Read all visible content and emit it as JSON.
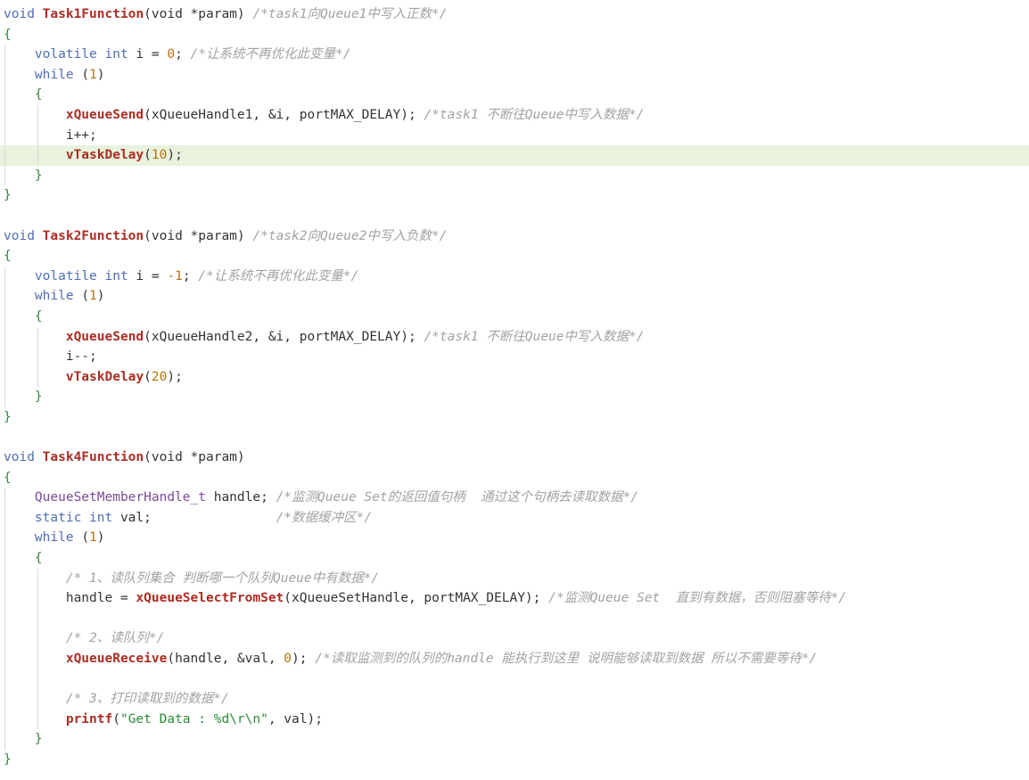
{
  "editor": {
    "lines": [
      {
        "indent": 0,
        "highlight": false,
        "tokens": [
          {
            "c": "kw",
            "t": "void "
          },
          {
            "c": "fn",
            "t": "Task1Function"
          },
          {
            "c": "paren",
            "t": "(void *param) "
          },
          {
            "c": "cm",
            "t": "/*task1向Queue1中写入正数*/"
          }
        ]
      },
      {
        "indent": 0,
        "highlight": false,
        "tokens": [
          {
            "c": "br-green",
            "t": "{"
          }
        ]
      },
      {
        "indent": 1,
        "highlight": false,
        "tokens": [
          {
            "c": "kw",
            "t": "volatile int "
          },
          {
            "c": "id",
            "t": "i = "
          },
          {
            "c": "num",
            "t": "0"
          },
          {
            "c": "op",
            "t": "; "
          },
          {
            "c": "cm",
            "t": "/*让系统不再优化此变量*/"
          }
        ]
      },
      {
        "indent": 1,
        "highlight": false,
        "tokens": [
          {
            "c": "kw",
            "t": "while "
          },
          {
            "c": "paren",
            "t": "("
          },
          {
            "c": "num",
            "t": "1"
          },
          {
            "c": "paren",
            "t": ")"
          }
        ]
      },
      {
        "indent": 1,
        "highlight": false,
        "tokens": [
          {
            "c": "br-green",
            "t": "{"
          }
        ]
      },
      {
        "indent": 2,
        "highlight": false,
        "tokens": [
          {
            "c": "fn",
            "t": "xQueueSend"
          },
          {
            "c": "paren",
            "t": "(xQueueHandle1, &i, portMAX_DELAY); "
          },
          {
            "c": "cm",
            "t": "/*task1 不断往Queue中写入数据*/"
          }
        ]
      },
      {
        "indent": 2,
        "highlight": false,
        "tokens": [
          {
            "c": "id",
            "t": "i++;"
          }
        ]
      },
      {
        "indent": 2,
        "highlight": true,
        "tokens": [
          {
            "c": "fn",
            "t": "vTaskDelay"
          },
          {
            "c": "paren",
            "t": "("
          },
          {
            "c": "num",
            "t": "10"
          },
          {
            "c": "paren",
            "t": ");"
          }
        ]
      },
      {
        "indent": 1,
        "highlight": false,
        "tokens": [
          {
            "c": "br-green",
            "t": "}"
          }
        ]
      },
      {
        "indent": 0,
        "highlight": false,
        "tokens": [
          {
            "c": "br-green",
            "t": "}"
          }
        ]
      },
      {
        "indent": 0,
        "highlight": false,
        "tokens": []
      },
      {
        "indent": 0,
        "highlight": false,
        "tokens": [
          {
            "c": "kw",
            "t": "void "
          },
          {
            "c": "fn",
            "t": "Task2Function"
          },
          {
            "c": "paren",
            "t": "(void *param) "
          },
          {
            "c": "cm",
            "t": "/*task2向Queue2中写入负数*/"
          }
        ]
      },
      {
        "indent": 0,
        "highlight": false,
        "tokens": [
          {
            "c": "br-green",
            "t": "{"
          }
        ]
      },
      {
        "indent": 1,
        "highlight": false,
        "tokens": [
          {
            "c": "kw",
            "t": "volatile int "
          },
          {
            "c": "id",
            "t": "i = "
          },
          {
            "c": "num",
            "t": "-1"
          },
          {
            "c": "op",
            "t": "; "
          },
          {
            "c": "cm",
            "t": "/*让系统不再优化此变量*/"
          }
        ]
      },
      {
        "indent": 1,
        "highlight": false,
        "tokens": [
          {
            "c": "kw",
            "t": "while "
          },
          {
            "c": "paren",
            "t": "("
          },
          {
            "c": "num",
            "t": "1"
          },
          {
            "c": "paren",
            "t": ")"
          }
        ]
      },
      {
        "indent": 1,
        "highlight": false,
        "tokens": [
          {
            "c": "br-green",
            "t": "{"
          }
        ]
      },
      {
        "indent": 2,
        "highlight": false,
        "tokens": [
          {
            "c": "fn",
            "t": "xQueueSend"
          },
          {
            "c": "paren",
            "t": "(xQueueHandle2, &i, portMAX_DELAY); "
          },
          {
            "c": "cm",
            "t": "/*task1 不断往Queue中写入数据*/"
          }
        ]
      },
      {
        "indent": 2,
        "highlight": false,
        "tokens": [
          {
            "c": "id",
            "t": "i--;"
          }
        ]
      },
      {
        "indent": 2,
        "highlight": false,
        "tokens": [
          {
            "c": "fn",
            "t": "vTaskDelay"
          },
          {
            "c": "paren",
            "t": "("
          },
          {
            "c": "num",
            "t": "20"
          },
          {
            "c": "paren",
            "t": ");"
          }
        ]
      },
      {
        "indent": 1,
        "highlight": false,
        "tokens": [
          {
            "c": "br-green",
            "t": "}"
          }
        ]
      },
      {
        "indent": 0,
        "highlight": false,
        "tokens": [
          {
            "c": "br-green",
            "t": "}"
          }
        ]
      },
      {
        "indent": 0,
        "highlight": false,
        "tokens": []
      },
      {
        "indent": 0,
        "highlight": false,
        "tokens": [
          {
            "c": "kw",
            "t": "void "
          },
          {
            "c": "fn",
            "t": "Task4Function"
          },
          {
            "c": "paren",
            "t": "(void *param)"
          }
        ]
      },
      {
        "indent": 0,
        "highlight": false,
        "tokens": [
          {
            "c": "br-green",
            "t": "{"
          }
        ]
      },
      {
        "indent": 1,
        "highlight": false,
        "tokens": [
          {
            "c": "type",
            "t": "QueueSetMemberHandle_t "
          },
          {
            "c": "id",
            "t": "handle; "
          },
          {
            "c": "cm",
            "t": "/*监测Queue Set的返回值句柄  通过这个句柄去读取数据*/"
          }
        ]
      },
      {
        "indent": 1,
        "highlight": false,
        "tokens": [
          {
            "c": "kw",
            "t": "static int "
          },
          {
            "c": "id",
            "t": "val;                "
          },
          {
            "c": "cm",
            "t": "/*数据缓冲区*/"
          }
        ]
      },
      {
        "indent": 1,
        "highlight": false,
        "tokens": [
          {
            "c": "kw",
            "t": "while "
          },
          {
            "c": "paren",
            "t": "("
          },
          {
            "c": "num",
            "t": "1"
          },
          {
            "c": "paren",
            "t": ")"
          }
        ]
      },
      {
        "indent": 1,
        "highlight": false,
        "tokens": [
          {
            "c": "br-green",
            "t": "{"
          }
        ]
      },
      {
        "indent": 2,
        "highlight": false,
        "tokens": [
          {
            "c": "cm",
            "t": "/* 1、读队列集合 判断哪一个队列Queue中有数据*/"
          }
        ]
      },
      {
        "indent": 2,
        "highlight": false,
        "tokens": [
          {
            "c": "id",
            "t": "handle = "
          },
          {
            "c": "fn",
            "t": "xQueueSelectFromSet"
          },
          {
            "c": "paren",
            "t": "(xQueueSetHandle, portMAX_DELAY); "
          },
          {
            "c": "cm",
            "t": "/*监测Queue Set  直到有数据，否则阻塞等待*/"
          }
        ]
      },
      {
        "indent": 2,
        "highlight": false,
        "tokens": []
      },
      {
        "indent": 2,
        "highlight": false,
        "tokens": [
          {
            "c": "cm",
            "t": "/* 2、读队列*/"
          }
        ]
      },
      {
        "indent": 2,
        "highlight": false,
        "tokens": [
          {
            "c": "fn",
            "t": "xQueueReceive"
          },
          {
            "c": "paren",
            "t": "(handle, &val, "
          },
          {
            "c": "num",
            "t": "0"
          },
          {
            "c": "paren",
            "t": "); "
          },
          {
            "c": "cm",
            "t": "/*读取监测到的队列的handle 能执行到这里 说明能够读取到数据 所以不需要等待*/"
          }
        ]
      },
      {
        "indent": 2,
        "highlight": false,
        "tokens": []
      },
      {
        "indent": 2,
        "highlight": false,
        "tokens": [
          {
            "c": "cm",
            "t": "/* 3、打印读取到的数据*/"
          }
        ]
      },
      {
        "indent": 2,
        "highlight": false,
        "tokens": [
          {
            "c": "fn",
            "t": "printf"
          },
          {
            "c": "paren",
            "t": "("
          },
          {
            "c": "str",
            "t": "\"Get Data : %d\\r\\n\""
          },
          {
            "c": "paren",
            "t": ", val);"
          }
        ]
      },
      {
        "indent": 1,
        "highlight": false,
        "tokens": [
          {
            "c": "br-green",
            "t": "}"
          }
        ]
      },
      {
        "indent": 0,
        "highlight": false,
        "tokens": [
          {
            "c": "br-green",
            "t": "}"
          }
        ]
      }
    ]
  }
}
